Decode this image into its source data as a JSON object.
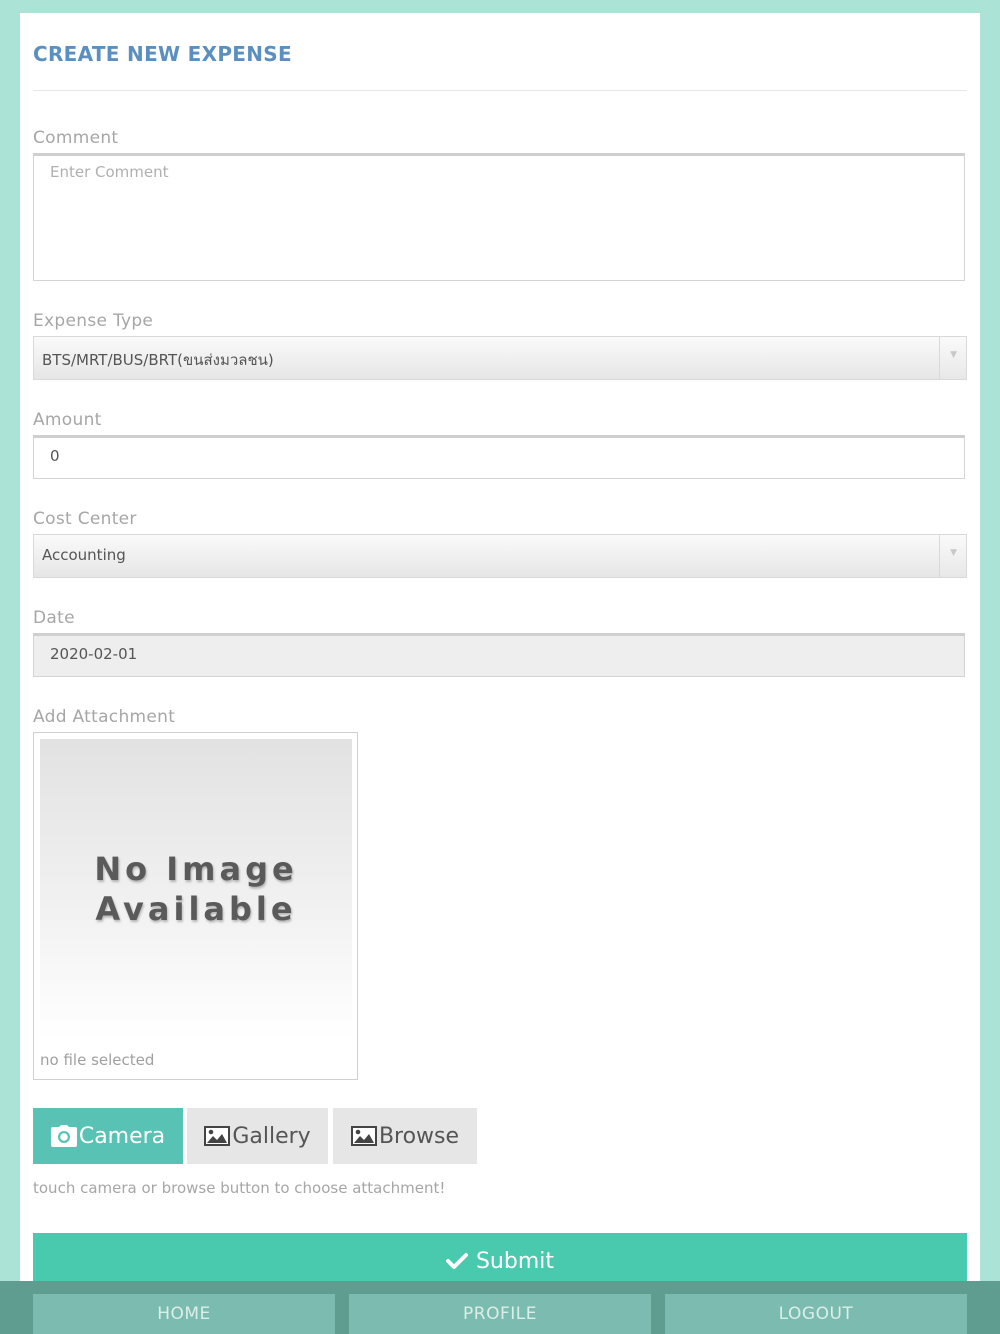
{
  "page": {
    "title": "CREATE NEW EXPENSE"
  },
  "form": {
    "comment": {
      "label": "Comment",
      "placeholder": "Enter Comment",
      "value": ""
    },
    "expense_type": {
      "label": "Expense Type",
      "selected": "BTS/MRT/BUS/BRT(ขนส่งมวลชน)"
    },
    "amount": {
      "label": "Amount",
      "value": "0"
    },
    "cost_center": {
      "label": "Cost Center",
      "selected": "Accounting"
    },
    "date": {
      "label": "Date",
      "value": "2020-02-01"
    },
    "attachment": {
      "label": "Add Attachment",
      "placeholder_line1": "No Image",
      "placeholder_line2": "Available",
      "status": "no file selected"
    }
  },
  "buttons": {
    "camera": "Camera",
    "gallery": "Gallery",
    "browse": "Browse",
    "hint": "touch camera or browse button to choose attachment!",
    "submit": "Submit"
  },
  "nav": {
    "home": "HOME",
    "profile": "PROFILE",
    "logout": "LOGOUT"
  },
  "colors": {
    "background": "#abe3d6",
    "title": "#5b8fbf",
    "camera_button": "#58c2b5",
    "submit_button": "#49c9ad",
    "bottom_bar": "#5f9d90",
    "nav_button": "#7cbcb0"
  },
  "icons": {
    "camera": "camera-icon",
    "gallery": "image-icon",
    "browse": "image-icon",
    "submit": "check-icon",
    "select_arrow": "chevron-down-icon"
  }
}
